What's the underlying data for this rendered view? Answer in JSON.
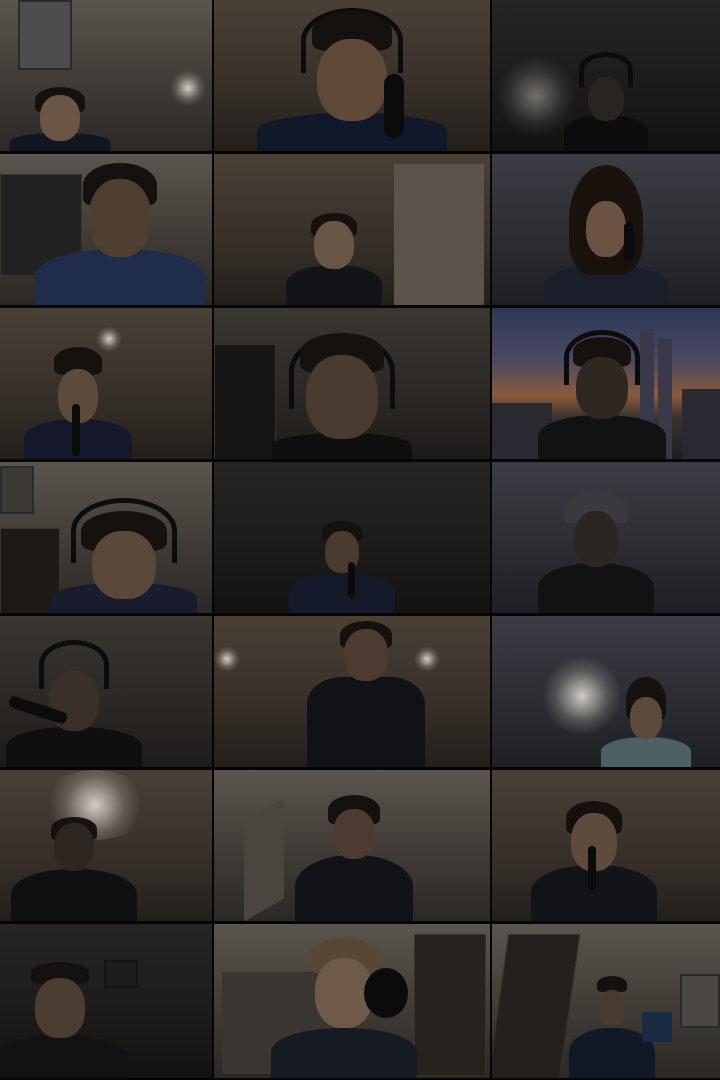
{
  "meeting": {
    "view": "gallery",
    "rows": 7,
    "columns": 3,
    "participant_count": 21
  },
  "participants": [
    {
      "row": 1,
      "col": 1,
      "scene": "person-room-ceiling"
    },
    {
      "row": 1,
      "col": 2,
      "scene": "person-headphones-microphone"
    },
    {
      "row": 1,
      "col": 3,
      "scene": "person-headphones-dark-room"
    },
    {
      "row": 2,
      "col": 1,
      "scene": "person-class-shirt"
    },
    {
      "row": 2,
      "col": 2,
      "scene": "person-near-door"
    },
    {
      "row": 2,
      "col": 3,
      "scene": "person-holding-microphone"
    },
    {
      "row": 3,
      "col": 1,
      "scene": "person-glasses-microphone"
    },
    {
      "row": 3,
      "col": 2,
      "scene": "person-headphones"
    },
    {
      "row": 3,
      "col": 3,
      "scene": "person-city-skyline-background"
    },
    {
      "row": 4,
      "col": 1,
      "scene": "person-headphones-bookshelf"
    },
    {
      "row": 4,
      "col": 2,
      "scene": "person-glasses-holding-microphone"
    },
    {
      "row": 4,
      "col": 3,
      "scene": "person-cap-dark-room"
    },
    {
      "row": 5,
      "col": 1,
      "scene": "person-microphone-stand"
    },
    {
      "row": 5,
      "col": 2,
      "scene": "person-ceiling-lights"
    },
    {
      "row": 5,
      "col": 3,
      "scene": "person-holding-microphone"
    },
    {
      "row": 6,
      "col": 1,
      "scene": "person-under-lamp"
    },
    {
      "row": 6,
      "col": 2,
      "scene": "person-polo-shirt"
    },
    {
      "row": 6,
      "col": 3,
      "scene": "person-holding-microphone"
    },
    {
      "row": 7,
      "col": 1,
      "scene": "person-glasses"
    },
    {
      "row": 7,
      "col": 2,
      "scene": "person-studio-microphone"
    },
    {
      "row": 7,
      "col": 3,
      "scene": "person-holding-sheet-music"
    }
  ]
}
